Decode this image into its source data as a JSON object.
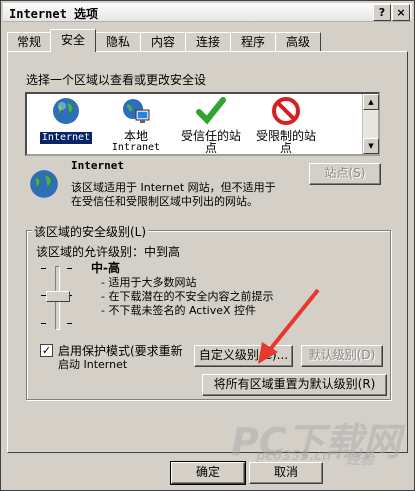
{
  "window": {
    "title": "Internet 选项",
    "help_btn": "?",
    "close_btn": "×"
  },
  "tabs": [
    "常规",
    "安全",
    "隐私",
    "内容",
    "连接",
    "程序",
    "高级"
  ],
  "active_tab": 1,
  "zone_prompt": "选择一个区域以查看或更改安全设",
  "zones": [
    {
      "line1": "Internet",
      "line2": "",
      "icon": "globe-icon",
      "selected": true
    },
    {
      "line1": "本地",
      "line2": "Intranet",
      "icon": "intranet-icon",
      "selected": false
    },
    {
      "line1": "受信任的站",
      "line2": "点",
      "icon": "check-icon",
      "selected": false
    },
    {
      "line1": "受限制的站",
      "line2": "点",
      "icon": "restricted-icon",
      "selected": false
    }
  ],
  "zone_info": {
    "title": "Internet",
    "desc_line1": "该区域适用于 Internet 网站，但不适用于",
    "desc_line2": "在受信任和受限制区域中列出的网站。",
    "sites_button": "站点(S)"
  },
  "security_level": {
    "group_label": "该区域的安全级别(L)",
    "allowed_levels": "该区域的允许级别：中到高",
    "level_name": "中-高",
    "bullets": [
      "适用于大多数网站",
      "在下载潜在的不安全内容之前提示",
      "不下载未签名的 ActiveX 控件"
    ],
    "slider_level_index": 2,
    "slider_level_count": 4
  },
  "protected_mode": {
    "checked": true,
    "line1": "启用保护模式(要求重新",
    "line2": "启动 Internet"
  },
  "buttons": {
    "custom_level": "自定义级别(C)...",
    "default_level": "默认级别(D)",
    "reset_all": "将所有区域重置为默认级别(R)",
    "ok": "确定",
    "cancel": "取消"
  },
  "watermark": {
    "text1": "PC下载网",
    "text2": "pc0359.cn",
    "text3": "经验"
  },
  "colors": {
    "arrow": "#e8382e",
    "selection": "#0a246a",
    "dialog_bg": "#d4d0c8"
  }
}
